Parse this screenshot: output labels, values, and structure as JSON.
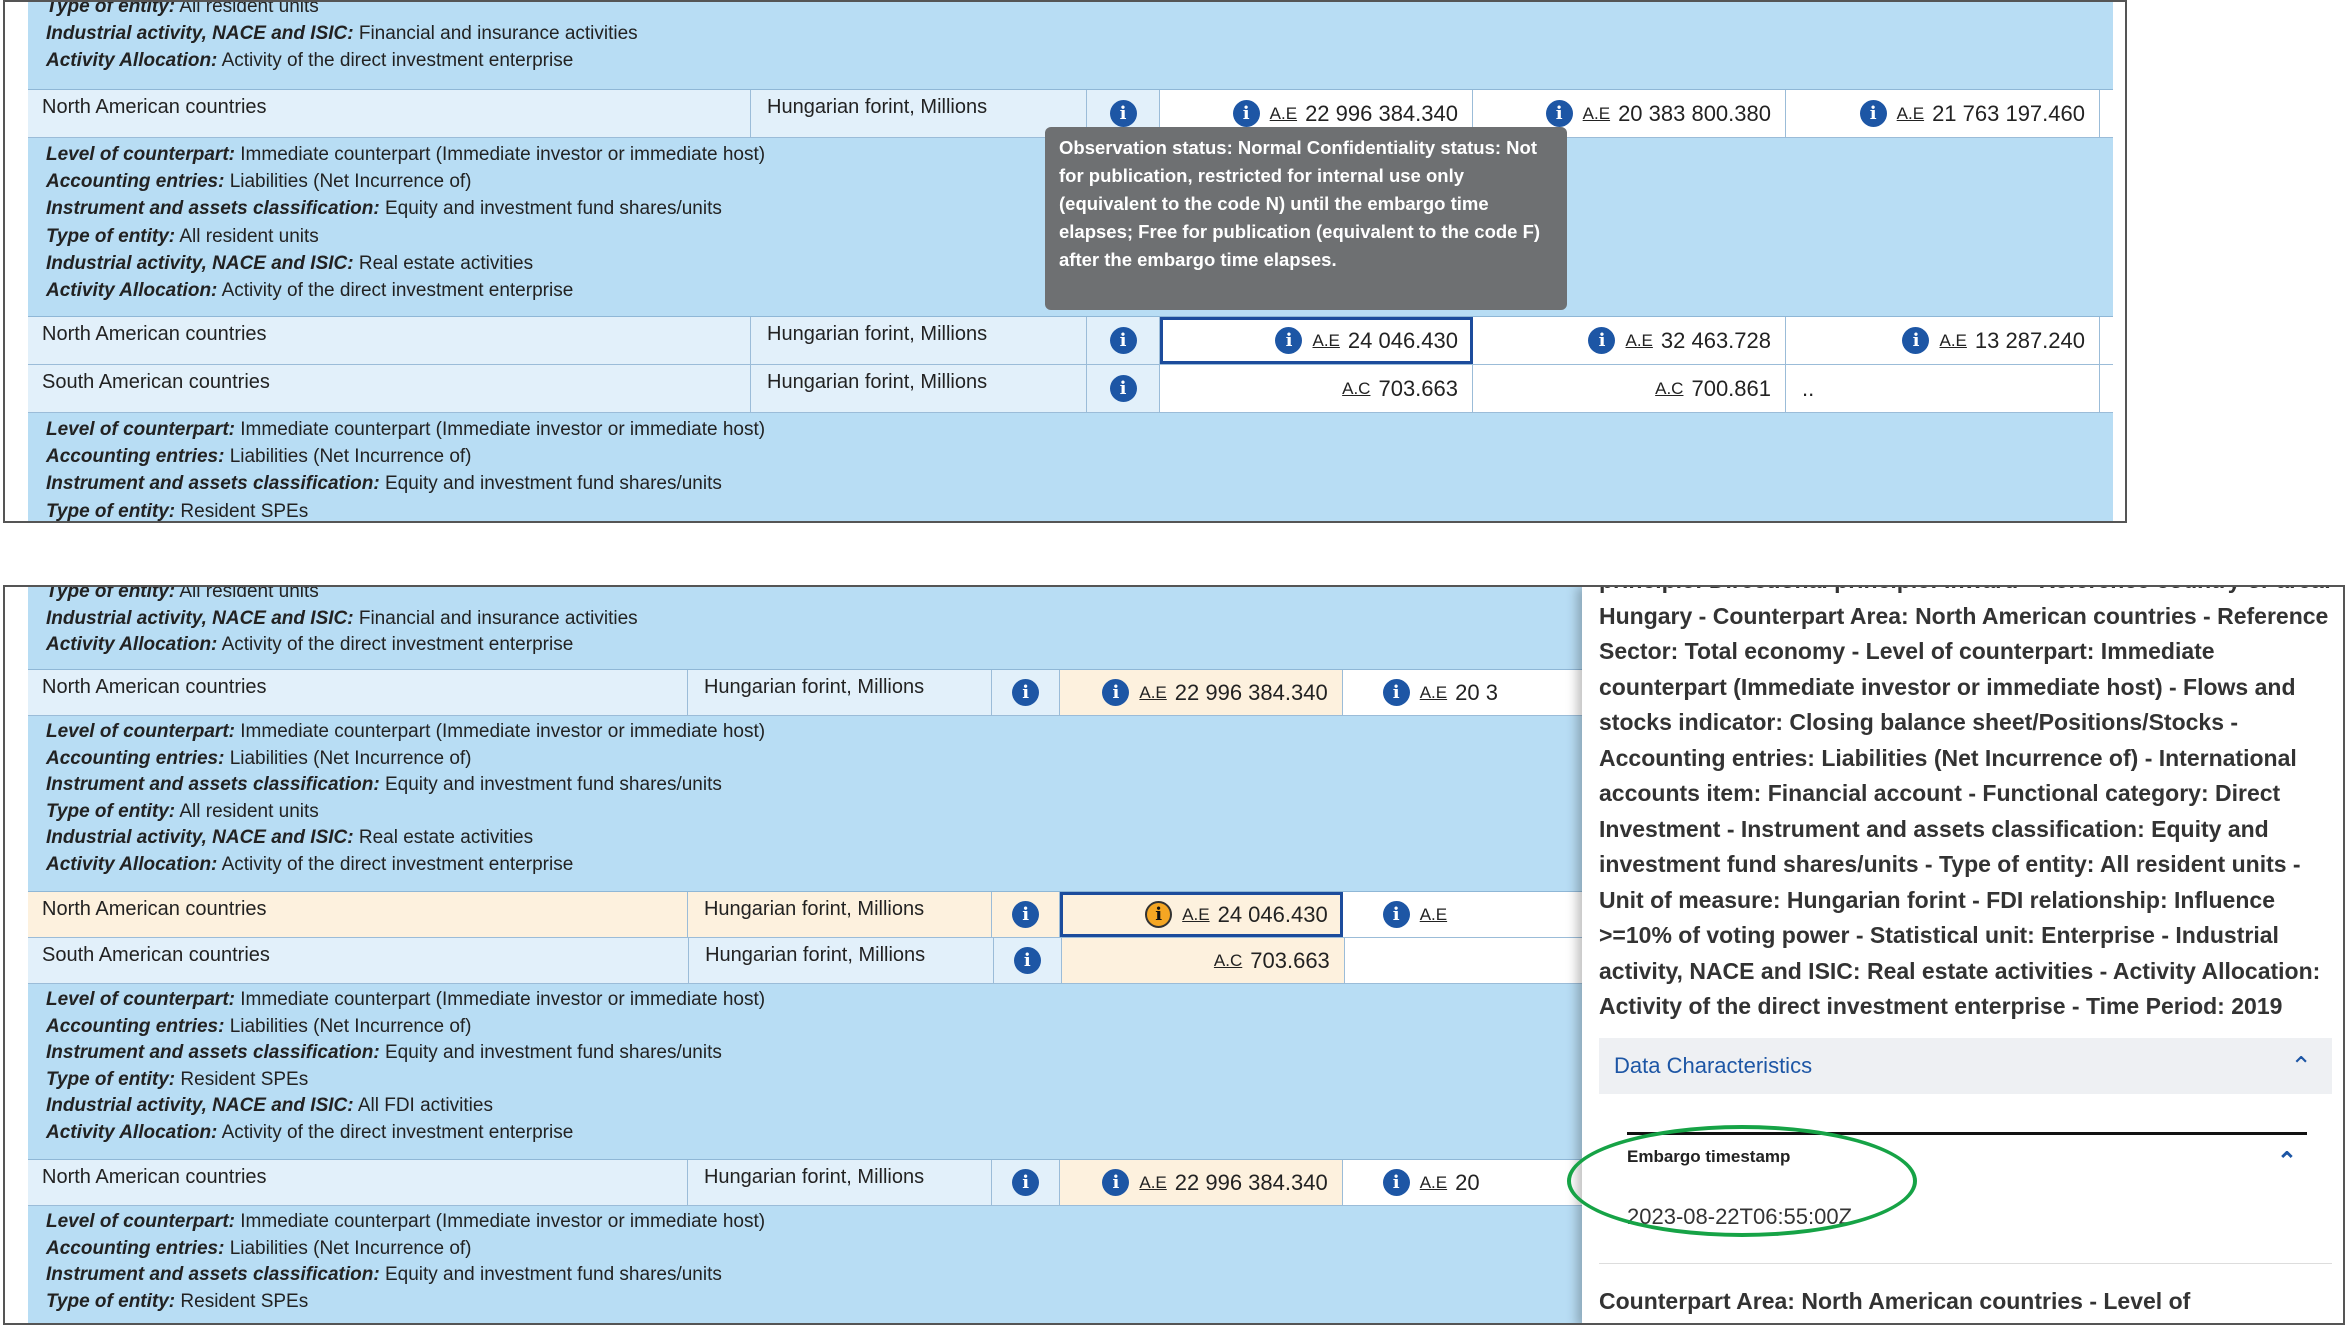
{
  "panel1": {
    "group0": {
      "lines": [
        {
          "k": "Type of entity:",
          "v": "All resident units"
        },
        {
          "k": "Industrial activity, NACE and ISIC:",
          "v": "Financial and insurance activities"
        },
        {
          "k": "Activity Allocation:",
          "v": "Activity of the direct investment enterprise"
        }
      ]
    },
    "row0": {
      "area": "North American countries",
      "unit": "Hungarian forint, Millions",
      "v1": "22 996 384.340",
      "f1": "A.E",
      "v2": "20 383 800.380",
      "f2": "A.E",
      "v3": "21 763 197.460",
      "f3": "A.E"
    },
    "group1": {
      "lines": [
        {
          "k": "Level of counterpart:",
          "v": "Immediate counterpart (Immediate investor or immediate host)"
        },
        {
          "k": "Accounting entries:",
          "v": "Liabilities (Net Incurrence of)"
        },
        {
          "k": "Instrument and assets classification:",
          "v": "Equity and investment fund shares/units"
        },
        {
          "k": "Type of entity:",
          "v": "All resident units"
        },
        {
          "k": "Industrial activity, NACE and ISIC:",
          "v": "Real estate activities"
        },
        {
          "k": "Activity Allocation:",
          "v": "Activity of the direct investment enterprise"
        }
      ]
    },
    "row1": {
      "area": "North American countries",
      "unit": "Hungarian forint, Millions",
      "v1": "24 046.430",
      "f1": "A.E",
      "v2": "32 463.728",
      "f2": "A.E",
      "v3": "13 287.240",
      "f3": "A.E"
    },
    "row2": {
      "area": "South American countries",
      "unit": "Hungarian forint, Millions",
      "v1": "703.663",
      "f1": "A.C",
      "v2": "700.861",
      "f2": "A.C",
      "v3": ".."
    },
    "group2": {
      "lines": [
        {
          "k": "Level of counterpart:",
          "v": "Immediate counterpart (Immediate investor or immediate host)"
        },
        {
          "k": "Accounting entries:",
          "v": "Liabilities (Net Incurrence of)"
        },
        {
          "k": "Instrument and assets classification:",
          "v": "Equity and investment fund shares/units"
        },
        {
          "k": "Type of entity:",
          "v": "Resident SPEs"
        }
      ]
    },
    "tooltip": "Observation status: Normal Confidentiality status: Not for publication, restricted for internal use only (equivalent to the code N) until the embargo time elapses; Free for publication (equivalent to the code F) after the embargo time elapses."
  },
  "panel2": {
    "group0": {
      "lines": [
        {
          "k": "Type of entity:",
          "v": "All resident units"
        },
        {
          "k": "Industrial activity, NACE and ISIC:",
          "v": "Financial and insurance activities"
        },
        {
          "k": "Activity Allocation:",
          "v": "Activity of the direct investment enterprise"
        }
      ]
    },
    "row0": {
      "area": "North American countries",
      "unit": "Hungarian forint, Millions",
      "v1": "22 996 384.340",
      "f1": "A.E",
      "v2": "20 3",
      "f2": "A.E"
    },
    "group1": {
      "lines": [
        {
          "k": "Level of counterpart:",
          "v": "Immediate counterpart (Immediate investor or immediate host)"
        },
        {
          "k": "Accounting entries:",
          "v": "Liabilities (Net Incurrence of)"
        },
        {
          "k": "Instrument and assets classification:",
          "v": "Equity and investment fund shares/units"
        },
        {
          "k": "Type of entity:",
          "v": "All resident units"
        },
        {
          "k": "Industrial activity, NACE and ISIC:",
          "v": "Real estate activities"
        },
        {
          "k": "Activity Allocation:",
          "v": "Activity of the direct investment enterprise"
        }
      ]
    },
    "row1": {
      "area": "North American countries",
      "unit": "Hungarian forint, Millions",
      "v1": "24 046.430",
      "f1": "A.E",
      "f2": "A.E"
    },
    "row2": {
      "area": "South American countries",
      "unit": "Hungarian forint, Millions",
      "v1": "703.663",
      "f1": "A.C"
    },
    "group2": {
      "lines": [
        {
          "k": "Level of counterpart:",
          "v": "Immediate counterpart (Immediate investor or immediate host)"
        },
        {
          "k": "Accounting entries:",
          "v": "Liabilities (Net Incurrence of)"
        },
        {
          "k": "Instrument and assets classification:",
          "v": "Equity and investment fund shares/units"
        },
        {
          "k": "Type of entity:",
          "v": "Resident SPEs"
        },
        {
          "k": "Industrial activity, NACE and ISIC:",
          "v": "All FDI activities"
        },
        {
          "k": "Activity Allocation:",
          "v": "Activity of the direct investment enterprise"
        }
      ]
    },
    "row3": {
      "area": "North American countries",
      "unit": "Hungarian forint, Millions",
      "v1": "22 996 384.340",
      "f1": "A.E",
      "v2": "20",
      "f2": "A.E"
    },
    "group3": {
      "lines": [
        {
          "k": "Level of counterpart:",
          "v": "Immediate counterpart (Immediate investor or immediate host)"
        },
        {
          "k": "Accounting entries:",
          "v": "Liabilities (Net Incurrence of)"
        },
        {
          "k": "Instrument and assets classification:",
          "v": "Equity and investment fund shares/units"
        },
        {
          "k": "Type of entity:",
          "v": "Resident SPEs"
        }
      ]
    },
    "side": {
      "top_text": "principle: Directional principle: Inward - Reference country or area: Hungary - Counterpart Area: North American countries - Reference Sector: Total economy - Level of counterpart: Immediate counterpart (Immediate investor or immediate host) - Flows and stocks indicator: Closing balance sheet/Positions/Stocks - Accounting entries: Liabilities (Net Incurrence of) - International accounts item: Financial account - Functional category: Direct Investment - Instrument and assets classification: Equity and investment fund shares/units - Type of entity: All resident units - Unit of measure: Hungarian forint - FDI relationship: Influence >=10% of voting power - Statistical unit: Enterprise - Industrial activity, NACE and ISIC: Real estate activities - Activity Allocation: Activity of the direct investment enterprise - Time Period: 2019",
      "data_characteristics": "Data Characteristics",
      "embargo_label": "Embargo timestamp",
      "embargo_value": "2023-08-22T06:55:00Z",
      "bottom_text": "Counterpart Area: North American countries - Level of counterpart:"
    }
  },
  "icons": {
    "info": "info-icon",
    "warning": "info-warning-icon",
    "chevron": "chevron-up-icon"
  },
  "colors": {
    "group_bg": "#b8ddf4",
    "row_bg": "#e2f0fa",
    "highlight": "#fdf1de",
    "accent": "#1d56a5",
    "circle": "#16a346"
  }
}
